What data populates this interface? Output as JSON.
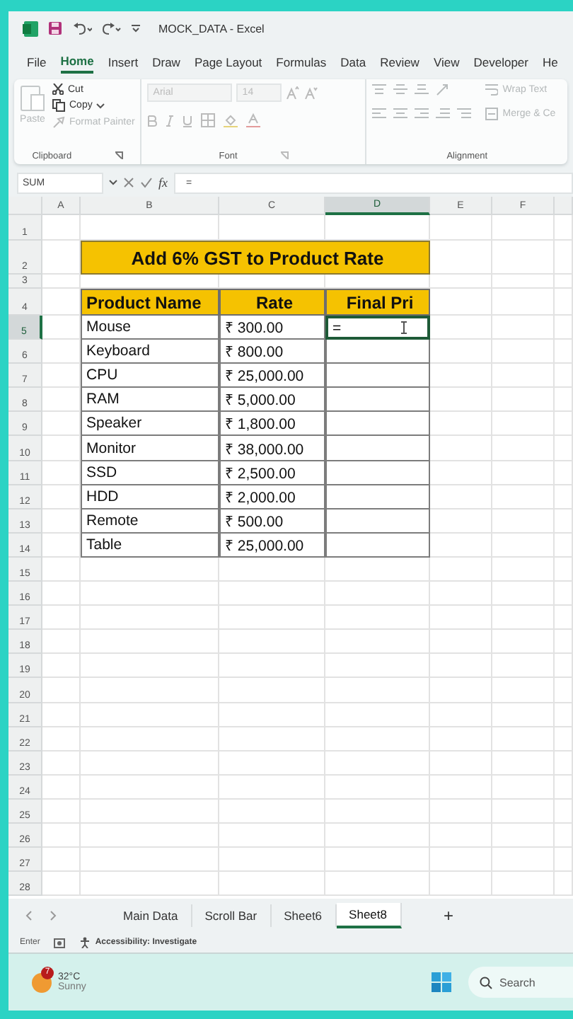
{
  "title_bar": {
    "title": "MOCK_DATA  -  Excel"
  },
  "menu_tabs": [
    {
      "label": "File",
      "selected": false
    },
    {
      "label": "Home",
      "selected": true
    },
    {
      "label": "Insert",
      "selected": false
    },
    {
      "label": "Draw",
      "selected": false
    },
    {
      "label": "Page Layout",
      "selected": false
    },
    {
      "label": "Formulas",
      "selected": false
    },
    {
      "label": "Data",
      "selected": false
    },
    {
      "label": "Review",
      "selected": false
    },
    {
      "label": "View",
      "selected": false
    },
    {
      "label": "Developer",
      "selected": false
    },
    {
      "label": "He",
      "selected": false
    }
  ],
  "ribbon": {
    "clipboard": {
      "label": "Clipboard",
      "paste": {
        "label": "Paste",
        "disabled": true
      },
      "cut": {
        "label": "Cut",
        "disabled": false
      },
      "copy": {
        "label": "Copy",
        "disabled": false
      },
      "format_painter": {
        "label": "Format Painter",
        "disabled": true
      }
    },
    "font": {
      "label": "Font",
      "font_name": "Arial",
      "font_size": "14",
      "disabled": true
    },
    "alignment": {
      "label": "Alignment",
      "wrap_text": "Wrap Text",
      "merge": "Merge & Ce",
      "disabled": true
    }
  },
  "formula_bar": {
    "name_box": "SUM",
    "fx": "fx",
    "formula": "="
  },
  "sheet": {
    "columns": [
      {
        "label": "A",
        "selected": false
      },
      {
        "label": "B",
        "selected": false
      },
      {
        "label": "C",
        "selected": false
      },
      {
        "label": "D",
        "selected": true
      },
      {
        "label": "E",
        "selected": false
      },
      {
        "label": "F",
        "selected": false
      }
    ],
    "row_headers": [
      {
        "label": "1",
        "selected": false
      },
      {
        "label": "2",
        "selected": false
      },
      {
        "label": "3",
        "selected": false
      },
      {
        "label": "4",
        "selected": false
      },
      {
        "label": "5",
        "selected": true
      },
      {
        "label": "6",
        "selected": false
      },
      {
        "label": "7",
        "selected": false
      },
      {
        "label": "8",
        "selected": false
      },
      {
        "label": "9",
        "selected": false
      },
      {
        "label": "10",
        "selected": false
      },
      {
        "label": "11",
        "selected": false
      },
      {
        "label": "12",
        "selected": false
      },
      {
        "label": "13",
        "selected": false
      },
      {
        "label": "14",
        "selected": false
      },
      {
        "label": "15",
        "selected": false
      },
      {
        "label": "16",
        "selected": false
      },
      {
        "label": "17",
        "selected": false
      },
      {
        "label": "18",
        "selected": false
      },
      {
        "label": "19",
        "selected": false
      },
      {
        "label": "20",
        "selected": false
      },
      {
        "label": "21",
        "selected": false
      },
      {
        "label": "22",
        "selected": false
      },
      {
        "label": "23",
        "selected": false
      },
      {
        "label": "24",
        "selected": false
      },
      {
        "label": "25",
        "selected": false
      },
      {
        "label": "26",
        "selected": false
      },
      {
        "label": "27",
        "selected": false
      },
      {
        "label": "28",
        "selected": false
      }
    ],
    "title": "Add 6% GST to Product Rate",
    "headers": [
      "Product Name",
      "Rate",
      "Final Pri"
    ],
    "rows": [
      {
        "name": "Mouse",
        "rate": "₹ 300.00",
        "final": "=",
        "editing": true
      },
      {
        "name": "Keyboard",
        "rate": "₹ 800.00",
        "editing": false
      },
      {
        "name": "CPU",
        "rate": "₹ 25,000.00",
        "editing": false
      },
      {
        "name": "RAM",
        "rate": "₹ 5,000.00",
        "editing": false
      },
      {
        "name": "Speaker",
        "rate": "₹ 1,800.00",
        "editing": false
      },
      {
        "name": "Monitor",
        "rate": "₹ 38,000.00",
        "editing": false
      },
      {
        "name": "SSD",
        "rate": "₹ 2,500.00",
        "editing": false
      },
      {
        "name": "HDD",
        "rate": "₹ 2,000.00",
        "editing": false
      },
      {
        "name": "Remote",
        "rate": "₹ 500.00",
        "editing": false
      },
      {
        "name": "Table",
        "rate": "₹ 25,000.00",
        "editing": false
      }
    ]
  },
  "sheet_tabs": [
    {
      "label": "Main Data",
      "selected": false
    },
    {
      "label": "Scroll Bar",
      "selected": false
    },
    {
      "label": "Sheet6",
      "selected": false
    },
    {
      "label": "Sheet8",
      "selected": true
    }
  ],
  "add_sheet": "+",
  "status_bar": {
    "mode": "Enter",
    "accessibility": "Accessibility: Investigate"
  },
  "taskbar": {
    "weather": {
      "badge": "7",
      "temperature": "32°C",
      "condition": "Sunny"
    },
    "search": {
      "placeholder": "Search"
    }
  }
}
